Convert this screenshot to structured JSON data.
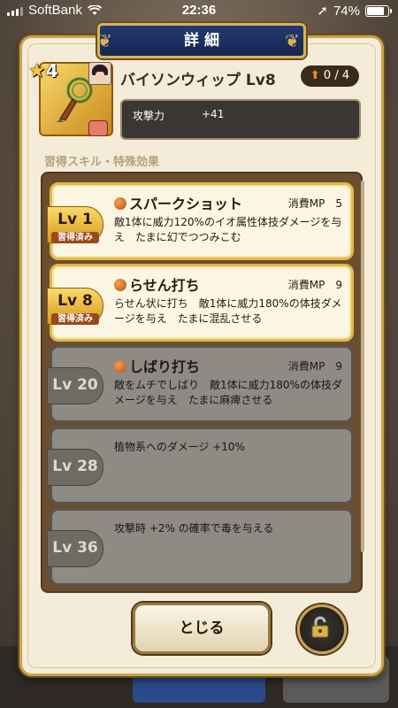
{
  "status_bar": {
    "carrier": "SoftBank",
    "time": "22:36",
    "battery": "74%",
    "battery_level": 0.74
  },
  "dialog": {
    "title": "詳 細"
  },
  "item": {
    "name": "バイソンウィップ Lv8",
    "rarity_stars": "4",
    "counter": "0 / 4",
    "stat_label": "攻撃力",
    "stat_value": "+41",
    "icon": "whip-icon"
  },
  "section_label": "習得スキル・特殊効果",
  "skills": [
    {
      "level": "Lv 1",
      "learned_badge": "習得済み",
      "name": "スパークショット",
      "mp": "消費MP　5",
      "desc": "敵1体に威力120%のイオ属性体技ダメージを与え　たまに幻でつつみこむ"
    },
    {
      "level": "Lv 8",
      "learned_badge": "習得済み",
      "name": "らせん打ち",
      "mp": "消費MP　9",
      "desc": "らせん状に打ち　敵1体に威力180%の体技ダメージを与え　たまに混乱させる"
    },
    {
      "level": "Lv 20",
      "name": "しばり打ち",
      "mp": "消費MP　9",
      "desc": "敵をムチでしばり　敵1体に威力180%の体技ダメージを与え　たまに麻痺させる"
    },
    {
      "level": "Lv 28",
      "desc": "植物系へのダメージ +10%"
    },
    {
      "level": "Lv 36",
      "desc": "攻撃時 +2% の確率で毒を与える"
    }
  ],
  "buttons": {
    "close": "とじる",
    "lock_icon": "unlock-icon"
  },
  "colors": {
    "panel": "#f4ecd8",
    "gold": "#c9a24e",
    "banner": "#233a72",
    "locked_card": "#8e8a84"
  }
}
